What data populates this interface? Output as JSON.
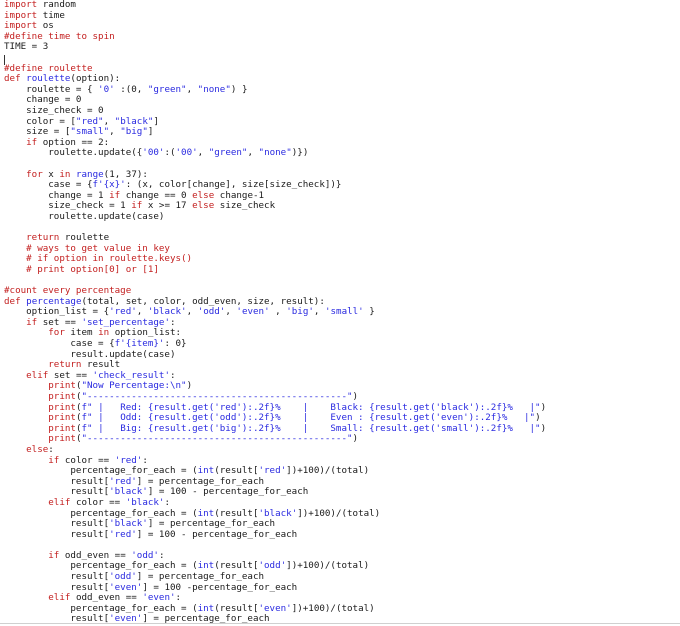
{
  "colors": {
    "keyword": "#c31f1f",
    "string": "#2a2ae0",
    "comment": "#c31f1f",
    "function": "#2a2ae0",
    "text": "#1a1a1a",
    "background": "#ffffff"
  },
  "lines": [
    [
      [
        "kw",
        "import"
      ],
      [
        "plain",
        " random"
      ]
    ],
    [
      [
        "kw",
        "import"
      ],
      [
        "plain",
        " time"
      ]
    ],
    [
      [
        "kw",
        "import"
      ],
      [
        "plain",
        " os"
      ]
    ],
    [
      [
        "cm",
        "#define time to spin"
      ]
    ],
    [
      [
        "plain",
        "TIME = 3"
      ]
    ],
    [
      [
        "plain",
        ""
      ]
    ],
    [
      [
        "cm",
        "#define roulette"
      ]
    ],
    [
      [
        "kw",
        "def"
      ],
      [
        "plain",
        " "
      ],
      [
        "fn",
        "roulette"
      ],
      [
        "plain",
        "(option):"
      ]
    ],
    [
      [
        "plain",
        "    roulette = { "
      ],
      [
        "str",
        "'0'"
      ],
      [
        "plain",
        " :(0, "
      ],
      [
        "str",
        "\"green\""
      ],
      [
        "plain",
        ", "
      ],
      [
        "str",
        "\"none\""
      ],
      [
        "plain",
        ") }"
      ]
    ],
    [
      [
        "plain",
        "    change = 0"
      ]
    ],
    [
      [
        "plain",
        "    size_check = 0"
      ]
    ],
    [
      [
        "plain",
        "    color = ["
      ],
      [
        "str",
        "\"red\""
      ],
      [
        "plain",
        ", "
      ],
      [
        "str",
        "\"black\""
      ],
      [
        "plain",
        "]"
      ]
    ],
    [
      [
        "plain",
        "    size = ["
      ],
      [
        "str",
        "\"small\""
      ],
      [
        "plain",
        ", "
      ],
      [
        "str",
        "\"big\""
      ],
      [
        "plain",
        "]"
      ]
    ],
    [
      [
        "plain",
        "    "
      ],
      [
        "kw",
        "if"
      ],
      [
        "plain",
        " option == 2:"
      ]
    ],
    [
      [
        "plain",
        "        roulette.update({"
      ],
      [
        "str",
        "'00'"
      ],
      [
        "plain",
        ":("
      ],
      [
        "str",
        "'00'"
      ],
      [
        "plain",
        ", "
      ],
      [
        "str",
        "\"green\""
      ],
      [
        "plain",
        ", "
      ],
      [
        "str",
        "\"none\""
      ],
      [
        "plain",
        ")})"
      ]
    ],
    [
      [
        "plain",
        ""
      ]
    ],
    [
      [
        "plain",
        "    "
      ],
      [
        "kw",
        "for"
      ],
      [
        "plain",
        " x "
      ],
      [
        "kw",
        "in"
      ],
      [
        "plain",
        " "
      ],
      [
        "fn",
        "range"
      ],
      [
        "plain",
        "(1, 37):"
      ]
    ],
    [
      [
        "plain",
        "        case = {"
      ],
      [
        "str",
        "f'{x}'"
      ],
      [
        "plain",
        ": (x, color[change], size[size_check])}"
      ]
    ],
    [
      [
        "plain",
        "        change = 1 "
      ],
      [
        "kw",
        "if"
      ],
      [
        "plain",
        " change == 0 "
      ],
      [
        "kw",
        "else"
      ],
      [
        "plain",
        " change-1"
      ]
    ],
    [
      [
        "plain",
        "        size_check = 1 "
      ],
      [
        "kw",
        "if"
      ],
      [
        "plain",
        " x >= 17 "
      ],
      [
        "kw",
        "else"
      ],
      [
        "plain",
        " size_check"
      ]
    ],
    [
      [
        "plain",
        "        roulette.update(case)"
      ]
    ],
    [
      [
        "plain",
        ""
      ]
    ],
    [
      [
        "plain",
        "    "
      ],
      [
        "kw",
        "return"
      ],
      [
        "plain",
        " roulette"
      ]
    ],
    [
      [
        "plain",
        "    "
      ],
      [
        "cm",
        "# ways to get value in key"
      ]
    ],
    [
      [
        "plain",
        "    "
      ],
      [
        "cm",
        "# if option in roulette.keys()"
      ]
    ],
    [
      [
        "plain",
        "    "
      ],
      [
        "cm",
        "# print option[0] or [1]"
      ]
    ],
    [
      [
        "plain",
        ""
      ]
    ],
    [
      [
        "cm",
        "#count every percentage"
      ]
    ],
    [
      [
        "kw",
        "def"
      ],
      [
        "plain",
        " "
      ],
      [
        "fn",
        "percentage"
      ],
      [
        "plain",
        "(total, set, color, odd_even, size, result):"
      ]
    ],
    [
      [
        "plain",
        "    option_list = {"
      ],
      [
        "str",
        "'red'"
      ],
      [
        "plain",
        ", "
      ],
      [
        "str",
        "'black'"
      ],
      [
        "plain",
        ", "
      ],
      [
        "str",
        "'odd'"
      ],
      [
        "plain",
        ", "
      ],
      [
        "str",
        "'even'"
      ],
      [
        "plain",
        " , "
      ],
      [
        "str",
        "'big'"
      ],
      [
        "plain",
        ", "
      ],
      [
        "str",
        "'small'"
      ],
      [
        "plain",
        " }"
      ]
    ],
    [
      [
        "plain",
        "    "
      ],
      [
        "kw",
        "if"
      ],
      [
        "plain",
        " set == "
      ],
      [
        "str",
        "'set_percentage'"
      ],
      [
        "plain",
        ":"
      ]
    ],
    [
      [
        "plain",
        "        "
      ],
      [
        "kw",
        "for"
      ],
      [
        "plain",
        " item "
      ],
      [
        "kw",
        "in"
      ],
      [
        "plain",
        " option_list:"
      ]
    ],
    [
      [
        "plain",
        "            case = {"
      ],
      [
        "str",
        "f'{item}'"
      ],
      [
        "plain",
        ": 0}"
      ]
    ],
    [
      [
        "plain",
        "            result.update(case)"
      ]
    ],
    [
      [
        "plain",
        "        "
      ],
      [
        "kw",
        "return"
      ],
      [
        "plain",
        " result"
      ]
    ],
    [
      [
        "plain",
        "    "
      ],
      [
        "kw",
        "elif"
      ],
      [
        "plain",
        " set == "
      ],
      [
        "str",
        "'check_result'"
      ],
      [
        "plain",
        ":"
      ]
    ],
    [
      [
        "plain",
        "        "
      ],
      [
        "kw",
        "print"
      ],
      [
        "plain",
        "("
      ],
      [
        "str",
        "\"Now Percentage:\\n\""
      ],
      [
        "plain",
        ")"
      ]
    ],
    [
      [
        "plain",
        "        "
      ],
      [
        "kw",
        "print"
      ],
      [
        "plain",
        "("
      ],
      [
        "str",
        "\"-----------------------------------------------\""
      ],
      [
        "plain",
        ")"
      ]
    ],
    [
      [
        "plain",
        "        "
      ],
      [
        "kw",
        "print"
      ],
      [
        "plain",
        "("
      ],
      [
        "str",
        "f\" |   Red: {result.get('red'):.2f}%    |    Black: {result.get('black'):.2f}%   |\""
      ],
      [
        "plain",
        ")"
      ]
    ],
    [
      [
        "plain",
        "        "
      ],
      [
        "kw",
        "print"
      ],
      [
        "plain",
        "("
      ],
      [
        "str",
        "f\" |   Odd: {result.get('odd'):.2f}%    |    Even : {result.get('even'):.2f}%   |\""
      ],
      [
        "plain",
        ")"
      ]
    ],
    [
      [
        "plain",
        "        "
      ],
      [
        "kw",
        "print"
      ],
      [
        "plain",
        "("
      ],
      [
        "str",
        "f\" |   Big: {result.get('big'):.2f}%    |    Small: {result.get('small'):.2f}%   |\""
      ],
      [
        "plain",
        ")"
      ]
    ],
    [
      [
        "plain",
        "        "
      ],
      [
        "kw",
        "print"
      ],
      [
        "plain",
        "("
      ],
      [
        "str",
        "\"-----------------------------------------------\""
      ],
      [
        "plain",
        ")"
      ]
    ],
    [
      [
        "plain",
        "    "
      ],
      [
        "kw",
        "else"
      ],
      [
        "plain",
        ":"
      ]
    ],
    [
      [
        "plain",
        "        "
      ],
      [
        "kw",
        "if"
      ],
      [
        "plain",
        " color == "
      ],
      [
        "str",
        "'red'"
      ],
      [
        "plain",
        ":"
      ]
    ],
    [
      [
        "plain",
        "            percentage_for_each = ("
      ],
      [
        "fn",
        "int"
      ],
      [
        "plain",
        "(result["
      ],
      [
        "str",
        "'red'"
      ],
      [
        "plain",
        "])+100)/(total)"
      ]
    ],
    [
      [
        "plain",
        "            result["
      ],
      [
        "str",
        "'red'"
      ],
      [
        "plain",
        "] = percentage_for_each"
      ]
    ],
    [
      [
        "plain",
        "            result["
      ],
      [
        "str",
        "'black'"
      ],
      [
        "plain",
        "] = 100 - percentage_for_each"
      ]
    ],
    [
      [
        "plain",
        "        "
      ],
      [
        "kw",
        "elif"
      ],
      [
        "plain",
        " color == "
      ],
      [
        "str",
        "'black'"
      ],
      [
        "plain",
        ":"
      ]
    ],
    [
      [
        "plain",
        "            percentage_for_each = ("
      ],
      [
        "fn",
        "int"
      ],
      [
        "plain",
        "(result["
      ],
      [
        "str",
        "'black'"
      ],
      [
        "plain",
        "])+100)/(total)"
      ]
    ],
    [
      [
        "plain",
        "            result["
      ],
      [
        "str",
        "'black'"
      ],
      [
        "plain",
        "] = percentage_for_each"
      ]
    ],
    [
      [
        "plain",
        "            result["
      ],
      [
        "str",
        "'red'"
      ],
      [
        "plain",
        "] = 100 - percentage_for_each"
      ]
    ],
    [
      [
        "plain",
        ""
      ]
    ],
    [
      [
        "plain",
        "        "
      ],
      [
        "kw",
        "if"
      ],
      [
        "plain",
        " odd_even == "
      ],
      [
        "str",
        "'odd'"
      ],
      [
        "plain",
        ":"
      ]
    ],
    [
      [
        "plain",
        "            percentage_for_each = ("
      ],
      [
        "fn",
        "int"
      ],
      [
        "plain",
        "(result["
      ],
      [
        "str",
        "'odd'"
      ],
      [
        "plain",
        "])+100)/(total)"
      ]
    ],
    [
      [
        "plain",
        "            result["
      ],
      [
        "str",
        "'odd'"
      ],
      [
        "plain",
        "] = percentage_for_each"
      ]
    ],
    [
      [
        "plain",
        "            result["
      ],
      [
        "str",
        "'even'"
      ],
      [
        "plain",
        "] = 100 -percentage_for_each"
      ]
    ],
    [
      [
        "plain",
        "        "
      ],
      [
        "kw",
        "elif"
      ],
      [
        "plain",
        " odd_even == "
      ],
      [
        "str",
        "'even'"
      ],
      [
        "plain",
        ":"
      ]
    ],
    [
      [
        "plain",
        "            percentage_for_each = ("
      ],
      [
        "fn",
        "int"
      ],
      [
        "plain",
        "(result["
      ],
      [
        "str",
        "'even'"
      ],
      [
        "plain",
        "])+100)/(total)"
      ]
    ],
    [
      [
        "plain",
        "            result["
      ],
      [
        "str",
        "'even'"
      ],
      [
        "plain",
        "] = percentage_for_each"
      ]
    ]
  ]
}
